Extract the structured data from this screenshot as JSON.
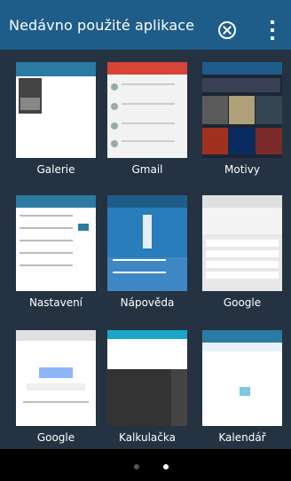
{
  "header": {
    "title": "Nedávno použité aplikace"
  },
  "apps": [
    {
      "label": "Galerie"
    },
    {
      "label": "Gmail"
    },
    {
      "label": "Motivy"
    },
    {
      "label": "Nastavení"
    },
    {
      "label": "Nápověda"
    },
    {
      "label": "Google"
    },
    {
      "label": "Google"
    },
    {
      "label": "Kalkulačka"
    },
    {
      "label": "Kalendář"
    }
  ],
  "colors": {
    "header": "#1e5c8a",
    "grid_bg": "#243242"
  },
  "pager": {
    "pages": 2,
    "active": 2
  }
}
